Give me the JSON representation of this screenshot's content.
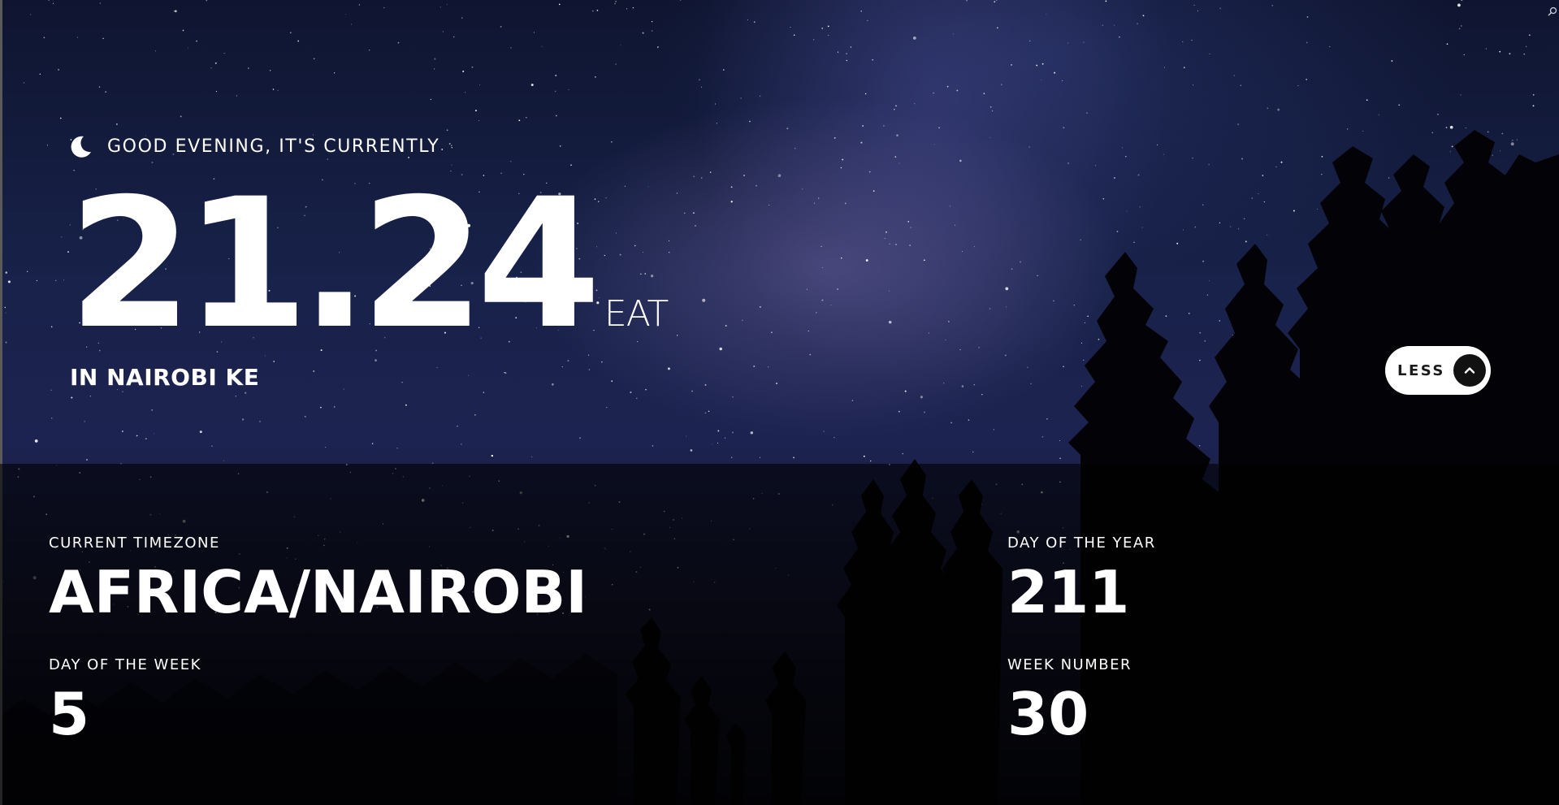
{
  "greeting": {
    "icon": "moon-icon",
    "text": "GOOD EVENING, IT'S CURRENTLY"
  },
  "clock": {
    "time": "21.24",
    "abbreviation": "EAT"
  },
  "location": "IN NAIROBI KE",
  "toggle": {
    "label": "LESS",
    "icon": "chevron-up-icon"
  },
  "details": {
    "timezone": {
      "label": "CURRENT TIMEZONE",
      "value": "AFRICA/NAIROBI"
    },
    "day_of_week": {
      "label": "DAY OF THE WEEK",
      "value": "5"
    },
    "day_of_year": {
      "label": "DAY OF THE YEAR",
      "value": "211"
    },
    "week_number": {
      "label": "WEEK NUMBER",
      "value": "30"
    }
  },
  "colors": {
    "text": "#ffffff",
    "button_bg": "#ffffff",
    "button_icon_bg": "#111111",
    "panel_overlay": "rgba(0,0,0,0.58)"
  }
}
